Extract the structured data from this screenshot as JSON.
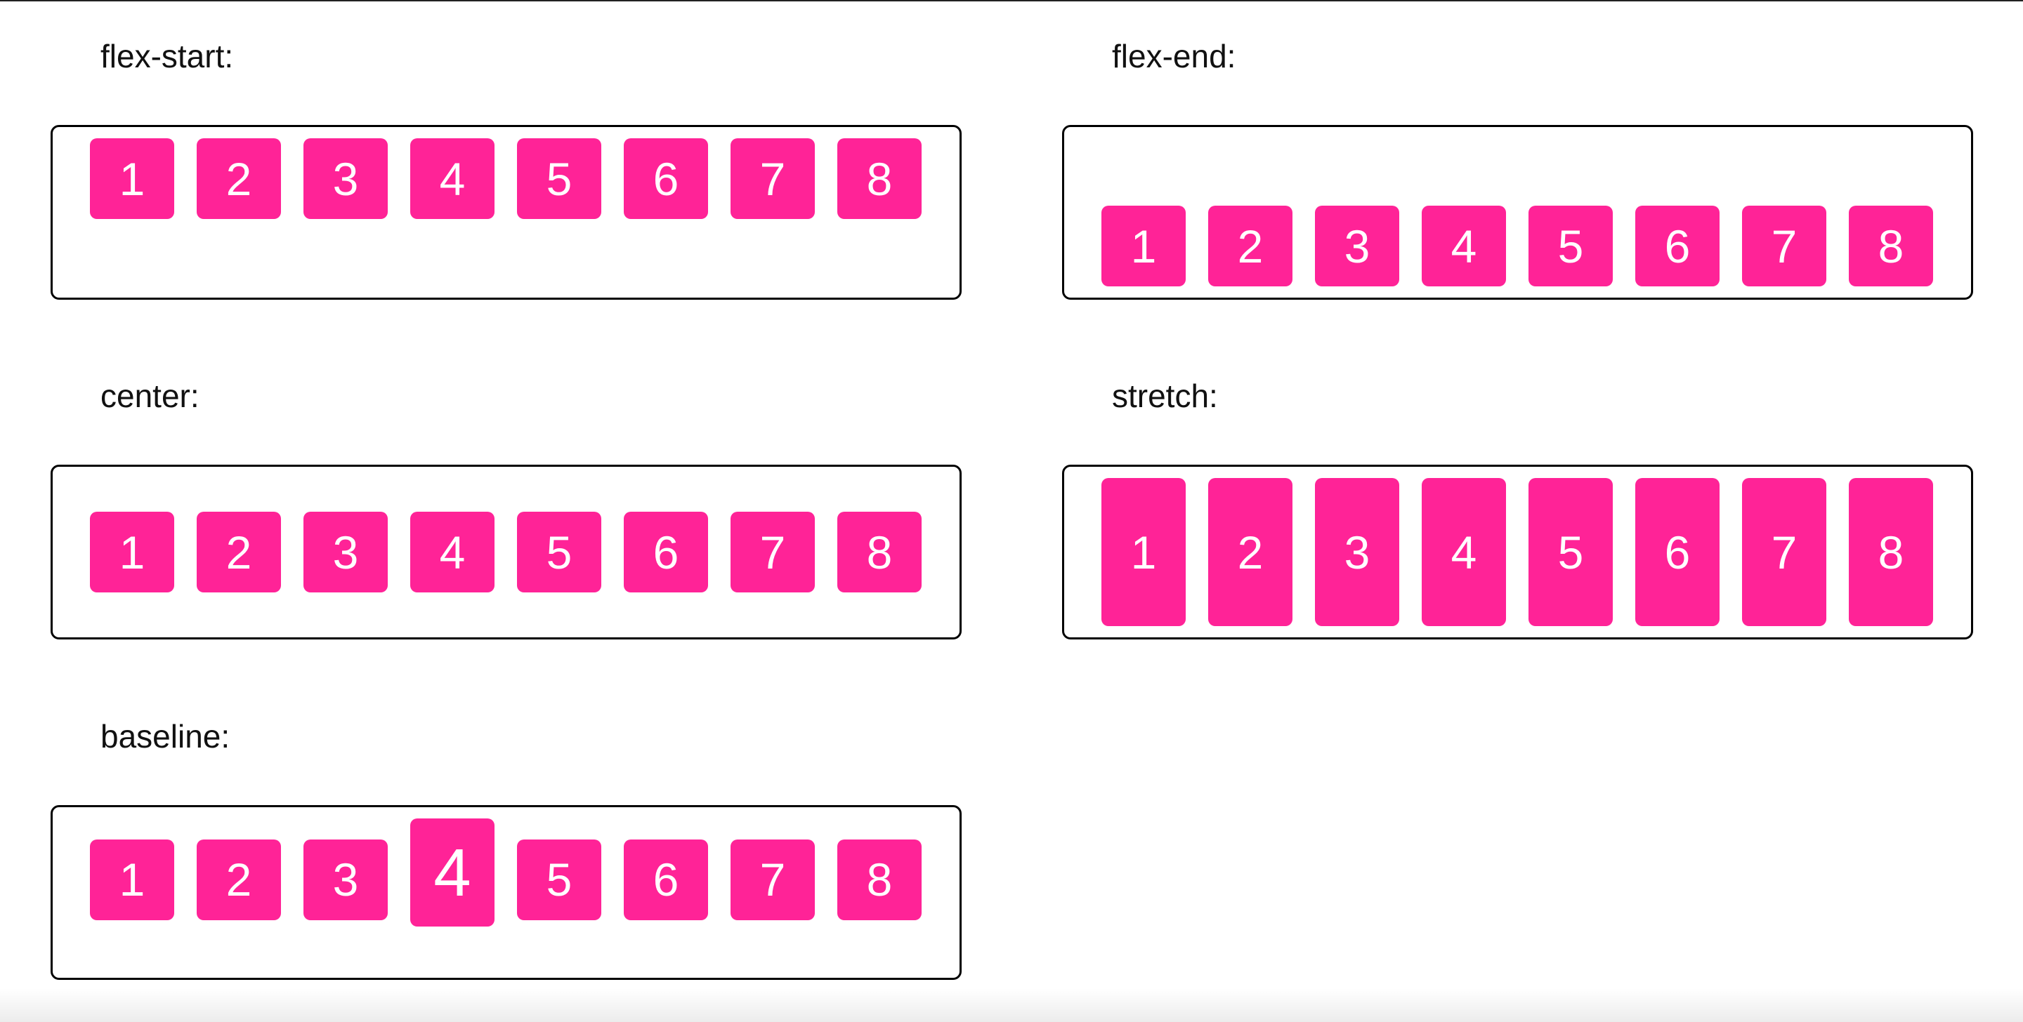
{
  "panels": [
    {
      "key": "flex_start",
      "label": "flex-start:",
      "items": [
        "1",
        "2",
        "3",
        "4",
        "5",
        "6",
        "7",
        "8"
      ]
    },
    {
      "key": "flex_end",
      "label": "flex-end:",
      "items": [
        "1",
        "2",
        "3",
        "4",
        "5",
        "6",
        "7",
        "8"
      ]
    },
    {
      "key": "center",
      "label": "center:",
      "items": [
        "1",
        "2",
        "3",
        "4",
        "5",
        "6",
        "7",
        "8"
      ]
    },
    {
      "key": "stretch",
      "label": "stretch:",
      "items": [
        "1",
        "2",
        "3",
        "4",
        "5",
        "6",
        "7",
        "8"
      ]
    },
    {
      "key": "baseline",
      "label": "baseline:",
      "items": [
        "1",
        "2",
        "3",
        "4",
        "5",
        "6",
        "7",
        "8"
      ]
    }
  ],
  "colors": {
    "item_background": "#ff2397",
    "item_text": "#ffffff",
    "border": "#000000"
  }
}
